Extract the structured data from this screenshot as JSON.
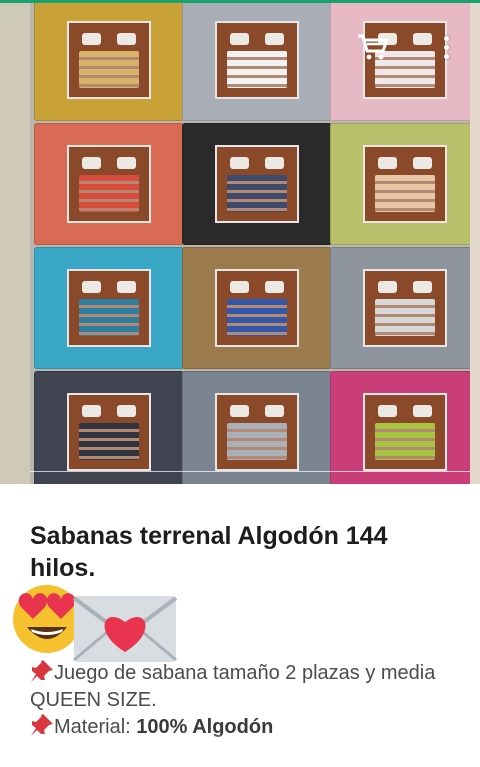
{
  "product": {
    "title": "Sabanas terrenal Algodón 144 hilos.",
    "description": [
      {
        "text": "Juego de sabana tamaño 2 plazas y media QUEEN SIZE."
      },
      {
        "label": "Material: ",
        "value": "100% Algodón"
      }
    ]
  },
  "gallery": {
    "packages": [
      {
        "name": "pkg-mustard-leaves",
        "bg": "#c9a237",
        "bed": "#d7b36a"
      },
      {
        "name": "pkg-grey-stripes",
        "bg": "#a9aeb6",
        "bed": "#f2f2f2"
      },
      {
        "name": "pkg-pink-floral",
        "bg": "#e7b9c4",
        "bed": "#efe7ea"
      },
      {
        "name": "pkg-orange-stripes",
        "bg": "#d96a54",
        "bed": "#d94b3b"
      },
      {
        "name": "pkg-black-white",
        "bg": "#2a2a2a",
        "bed": "#3d4a6b"
      },
      {
        "name": "pkg-green-floral",
        "bg": "#b9c06a",
        "bed": "#e9c6a6"
      },
      {
        "name": "pkg-teal-geo",
        "bg": "#3aa7c6",
        "bed": "#2d7fa1"
      },
      {
        "name": "pkg-wood-blue",
        "bg": "#9b7a4b",
        "bed": "#3257a8"
      },
      {
        "name": "pkg-grey-plaid",
        "bg": "#8d949b",
        "bed": "#d7d7d7"
      },
      {
        "name": "pkg-grey-lattice",
        "bg": "#3f4450",
        "bed": "#2f3440"
      },
      {
        "name": "pkg-stripe-circles",
        "bg": "#7b8591",
        "bed": "#aab0b8"
      },
      {
        "name": "pkg-pink-green",
        "bg": "#c93d79",
        "bed": "#a7c541"
      }
    ]
  },
  "colors": {
    "accent": "#1aa36f",
    "title": "#1d1d1d",
    "text": "#4b4b4b"
  },
  "icons": {
    "cart": "cart-icon",
    "menu": "more-vert-icon",
    "pin": "pushpin-icon"
  }
}
